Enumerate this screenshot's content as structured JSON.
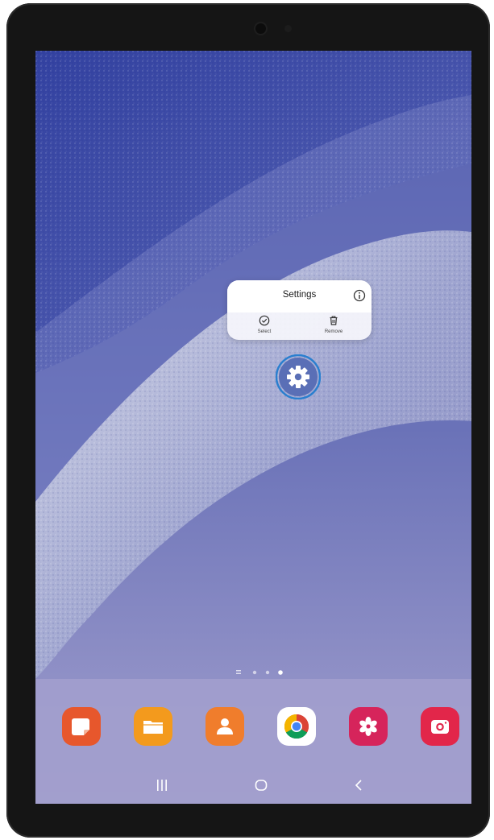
{
  "context_menu": {
    "title": "Settings",
    "info_icon": "info-icon",
    "actions": [
      {
        "label": "Select",
        "icon": "check-circle-icon"
      },
      {
        "label": "Remove",
        "icon": "trash-icon"
      }
    ]
  },
  "home": {
    "focused_app": {
      "name": "Settings",
      "icon": "gear-icon"
    },
    "page_indicator": {
      "pages": 3,
      "active_page": 3,
      "has_home_marker": true
    },
    "dock": [
      {
        "icon": "notes-icon",
        "color": "#e7572c"
      },
      {
        "icon": "folder-icon",
        "color": "#f39a1d"
      },
      {
        "icon": "contacts-icon",
        "color": "#f07d2c"
      },
      {
        "icon": "chrome-icon",
        "color": "#ffffff"
      },
      {
        "icon": "flower-icon",
        "color": "#d6245b"
      },
      {
        "icon": "camera-icon",
        "color": "#e2264a"
      }
    ]
  },
  "navbar": [
    "recent-apps-icon",
    "home-icon",
    "back-icon"
  ],
  "colors": {
    "accent": "#2a7fcf",
    "wallpaper_base": "#a29fcd",
    "wallpaper_dark": "#3e4a9a"
  }
}
